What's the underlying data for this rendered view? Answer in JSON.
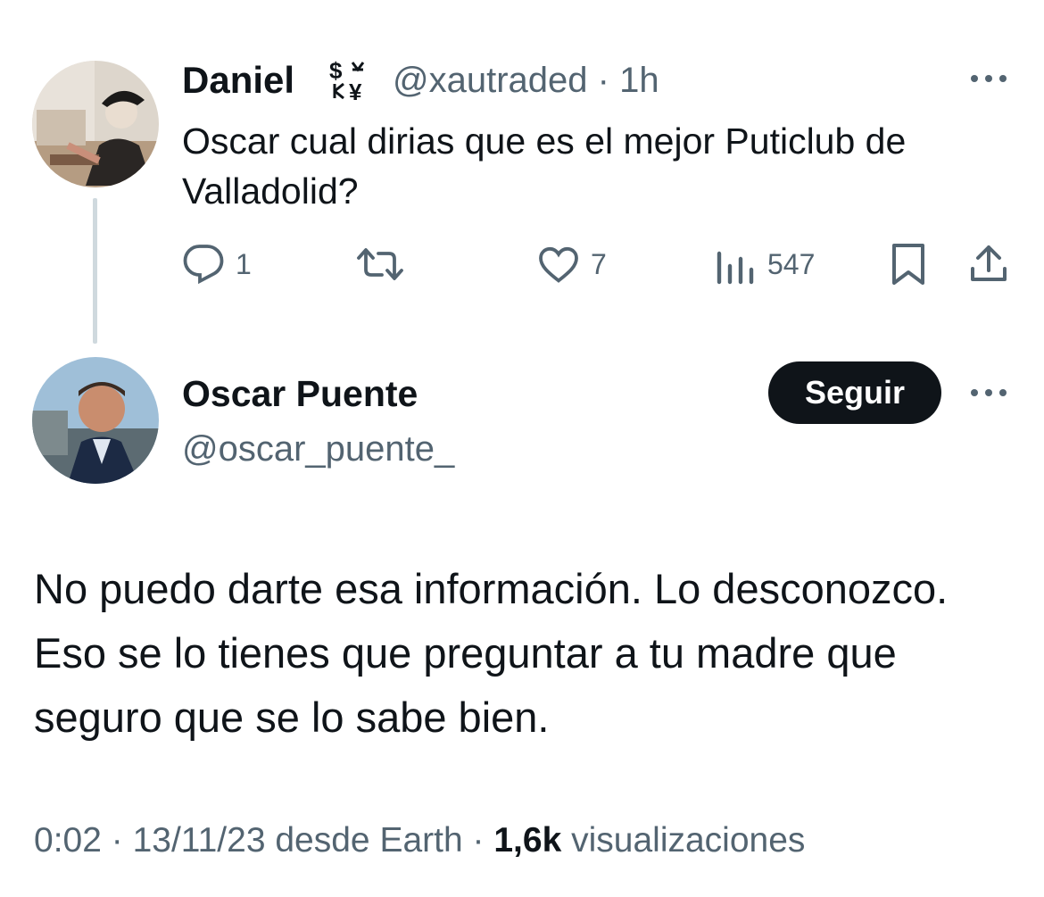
{
  "reply_tweet": {
    "author_name": "Daniel",
    "badge_icon": "currency-exchange-icon",
    "badge_glyphs": "$¥",
    "handle": "@xautraded",
    "separator": "·",
    "time": "1h",
    "text": "Oscar cual dirias que es el mejor Puticlub de Valladolid?",
    "actions": {
      "reply_count": "1",
      "retweet_count": "",
      "like_count": "7",
      "views_count": "547"
    }
  },
  "main_tweet": {
    "author_name": "Oscar Puente",
    "handle": "@oscar_puente_",
    "follow_label": "Seguir",
    "text": "No puedo darte esa información. Lo desconozco. Eso se lo tienes que preguntar a tu madre que seguro que se lo sabe bien.",
    "footer": {
      "time": "0:02",
      "sep1": "·",
      "date": "13/11/23",
      "source": "desde Earth",
      "sep2": "·",
      "views_count": "1,6k",
      "views_label": "visualizaciones"
    }
  },
  "colors": {
    "text": "#0f1419",
    "secondary": "#536471",
    "thread_line": "#cfd9de",
    "button_bg": "#0f1419",
    "button_text": "#ffffff"
  }
}
